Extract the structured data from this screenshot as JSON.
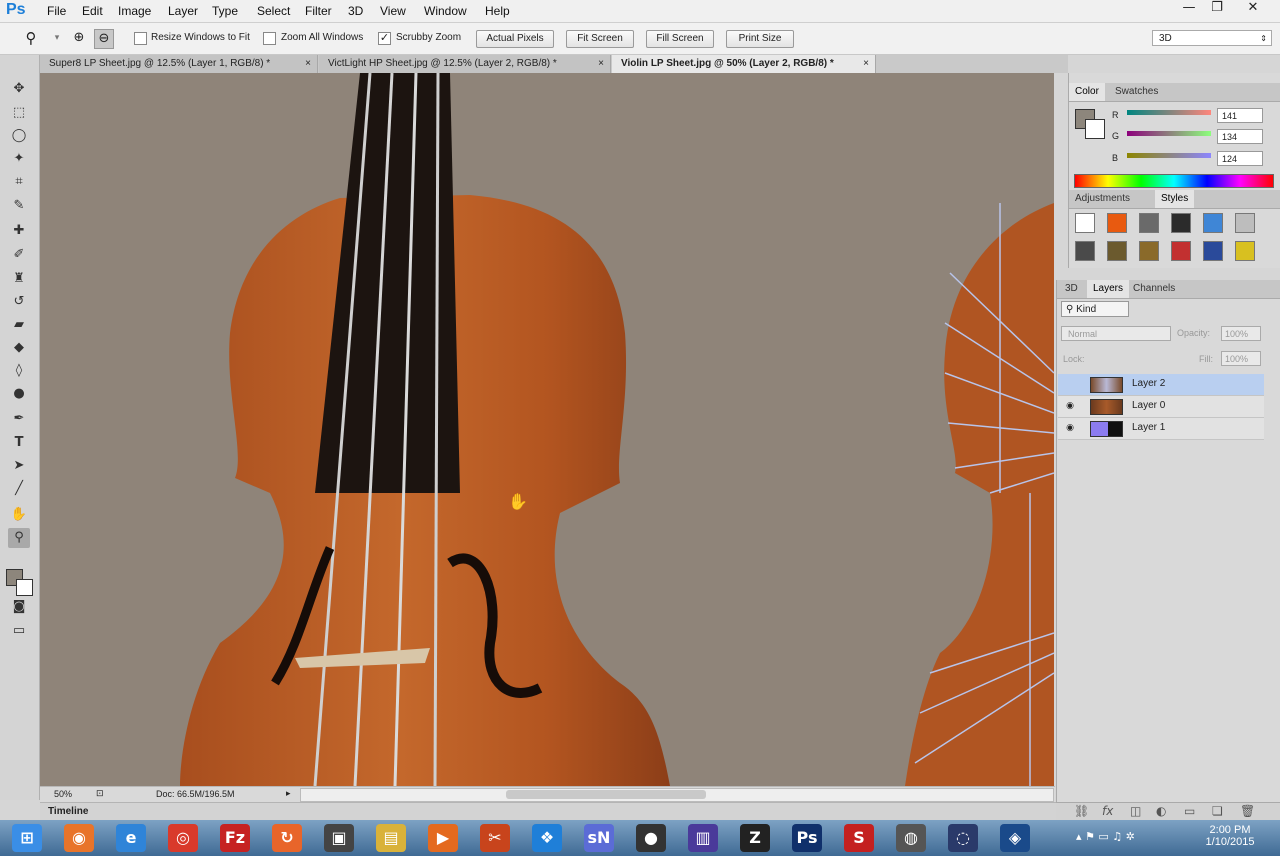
{
  "app": {
    "logo": "Ps"
  },
  "menu": [
    "File",
    "Edit",
    "Image",
    "Layer",
    "Type",
    "Select",
    "Filter",
    "3D",
    "View",
    "Window",
    "Help"
  ],
  "window_controls": {
    "minimize": "—",
    "restore": "❐",
    "close": "✕"
  },
  "options_bar": {
    "resize_windows_label": "Resize Windows to Fit",
    "resize_windows_checked": false,
    "zoom_all_label": "Zoom All Windows",
    "zoom_all_checked": false,
    "scrubby_label": "Scrubby Zoom",
    "scrubby_checked": true,
    "actual_pixels": "Actual Pixels",
    "fit_screen": "Fit Screen",
    "fill_screen": "Fill Screen",
    "print_size": "Print Size",
    "workspace": "3D"
  },
  "doc_tabs": [
    {
      "label": "Super8 LP Sheet.jpg @ 12.5% (Layer 1, RGB/8) *",
      "close": "×",
      "active": false
    },
    {
      "label": "VictLight HP Sheet.jpg @ 12.5% (Layer 2, RGB/8) *",
      "close": "×",
      "active": false
    },
    {
      "label": "Violin LP Sheet.jpg @ 50% (Layer 2, RGB/8) *",
      "close": "×",
      "active": true
    }
  ],
  "status": {
    "zoom": "50%",
    "doc": "Doc: 66.5M/196.5M"
  },
  "timeline_label": "Timeline",
  "color_panel": {
    "tabs": [
      "Color",
      "Swatches"
    ],
    "channels": [
      {
        "label": "R",
        "value": "141"
      },
      {
        "label": "G",
        "value": "134"
      },
      {
        "label": "B",
        "value": "124"
      }
    ],
    "foreground": "#8d867c"
  },
  "adjustments_panel": {
    "tabs": [
      "Adjustments",
      "Styles"
    ],
    "styles": [
      "#ffffff",
      "#e85a10",
      "#6a6a6a",
      "#2b2b2b",
      "#3f86d6",
      "#bdbdbd",
      "#4a4a4a",
      "#6b5a2e",
      "#8a6a2a",
      "#c23030",
      "#2a4a9a",
      "#d8c020"
    ]
  },
  "layers_panel": {
    "tabs": [
      "3D",
      "Layers",
      "Channels"
    ],
    "filter": "Kind",
    "blend_mode": "Normal",
    "opacity_label": "Opacity:",
    "opacity": "100%",
    "lock_label": "Lock:",
    "fill_label": "Fill:",
    "fill": "100%",
    "layers": [
      {
        "name": "Layer 2",
        "visible": false,
        "selected": true
      },
      {
        "name": "Layer 0",
        "visible": true,
        "selected": false
      },
      {
        "name": "Layer 1",
        "visible": true,
        "selected": false
      }
    ]
  },
  "taskbar": {
    "time": "2:00 PM",
    "date": "1/10/2015",
    "apps": [
      {
        "name": "start",
        "glyph": "⊞",
        "color": "#3a8ee6"
      },
      {
        "name": "firefox",
        "glyph": "◉",
        "color": "#e8742a"
      },
      {
        "name": "internet-explorer",
        "glyph": "e",
        "color": "#2f84d8"
      },
      {
        "name": "chrome",
        "glyph": "◎",
        "color": "#d93a2b"
      },
      {
        "name": "filezilla",
        "glyph": "Fz",
        "color": "#c62222"
      },
      {
        "name": "sync",
        "glyph": "↻",
        "color": "#e8652a"
      },
      {
        "name": "media",
        "glyph": "▣",
        "color": "#444444"
      },
      {
        "name": "explorer",
        "glyph": "▤",
        "color": "#d9b23a"
      },
      {
        "name": "player",
        "glyph": "▶",
        "color": "#e46a1f"
      },
      {
        "name": "tool",
        "glyph": "✂",
        "color": "#c8441c"
      },
      {
        "name": "dropbox",
        "glyph": "❖",
        "color": "#1f7fd8"
      },
      {
        "name": "sn",
        "glyph": "sN",
        "color": "#5b6cd6"
      },
      {
        "name": "game",
        "glyph": "●",
        "color": "#333333"
      },
      {
        "name": "editor",
        "glyph": "▥",
        "color": "#4a3a9a"
      },
      {
        "name": "zbrush",
        "glyph": "Z",
        "color": "#222222"
      },
      {
        "name": "photoshop",
        "glyph": "Ps",
        "color": "#10306b"
      },
      {
        "name": "substance",
        "glyph": "S",
        "color": "#c42020"
      },
      {
        "name": "app1",
        "glyph": "◍",
        "color": "#555555"
      },
      {
        "name": "app2",
        "glyph": "◌",
        "color": "#2a3a6a"
      },
      {
        "name": "app3",
        "glyph": "◈",
        "color": "#1a4a8a"
      }
    ]
  },
  "colors": {
    "canvas_bg": "#8f8479",
    "wood": "#b65a22",
    "selected_layer": "#b9cff0"
  }
}
